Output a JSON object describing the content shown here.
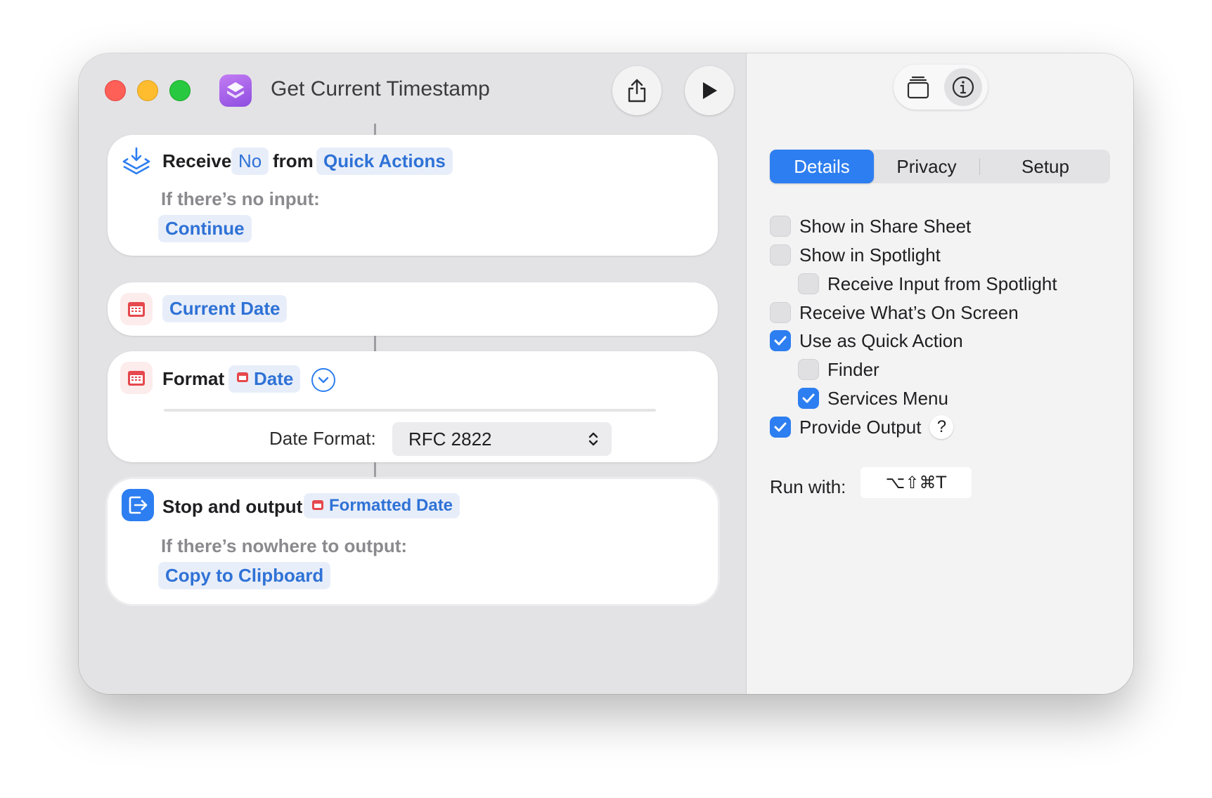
{
  "window": {
    "title": "Get Current Timestamp"
  },
  "toolbar": {
    "share_icon": "share-icon",
    "run_icon": "play-icon"
  },
  "actions": {
    "receive": {
      "label": "Receive",
      "input_type": "No",
      "from_label": "from",
      "source": "Quick Actions",
      "no_input_label": "If there’s no input:",
      "no_input_action": "Continue"
    },
    "current_date": {
      "label": "Current Date"
    },
    "format": {
      "label": "Format",
      "variable": "Date",
      "date_format_label": "Date Format:",
      "date_format_value": "RFC 2822"
    },
    "stop_output": {
      "label": "Stop and output",
      "variable": "Formatted Date",
      "nowhere_label": "If there’s nowhere to output:",
      "nowhere_action": "Copy to Clipboard"
    }
  },
  "inspector": {
    "tabs": [
      {
        "label": "Details",
        "active": true
      },
      {
        "label": "Privacy",
        "active": false
      },
      {
        "label": "Setup",
        "active": false
      }
    ],
    "options": [
      {
        "label": "Show in Share Sheet",
        "checked": false
      },
      {
        "label": "Show in Spotlight",
        "checked": false
      },
      {
        "label": "Receive Input from Spotlight",
        "checked": false
      },
      {
        "label": "Receive What’s On Screen",
        "checked": false
      },
      {
        "label": "Use as Quick Action",
        "checked": true
      },
      {
        "label": "Finder",
        "checked": false
      },
      {
        "label": "Services Menu",
        "checked": true
      },
      {
        "label": "Provide Output",
        "checked": true
      }
    ],
    "help_label": "?",
    "run_with_label": "Run with:",
    "shortcut": "⌥⇧⌘T"
  },
  "colors": {
    "accent": "#2d7ef0",
    "token_text": "#2f72d6",
    "calendar_red": "#e5484d"
  }
}
